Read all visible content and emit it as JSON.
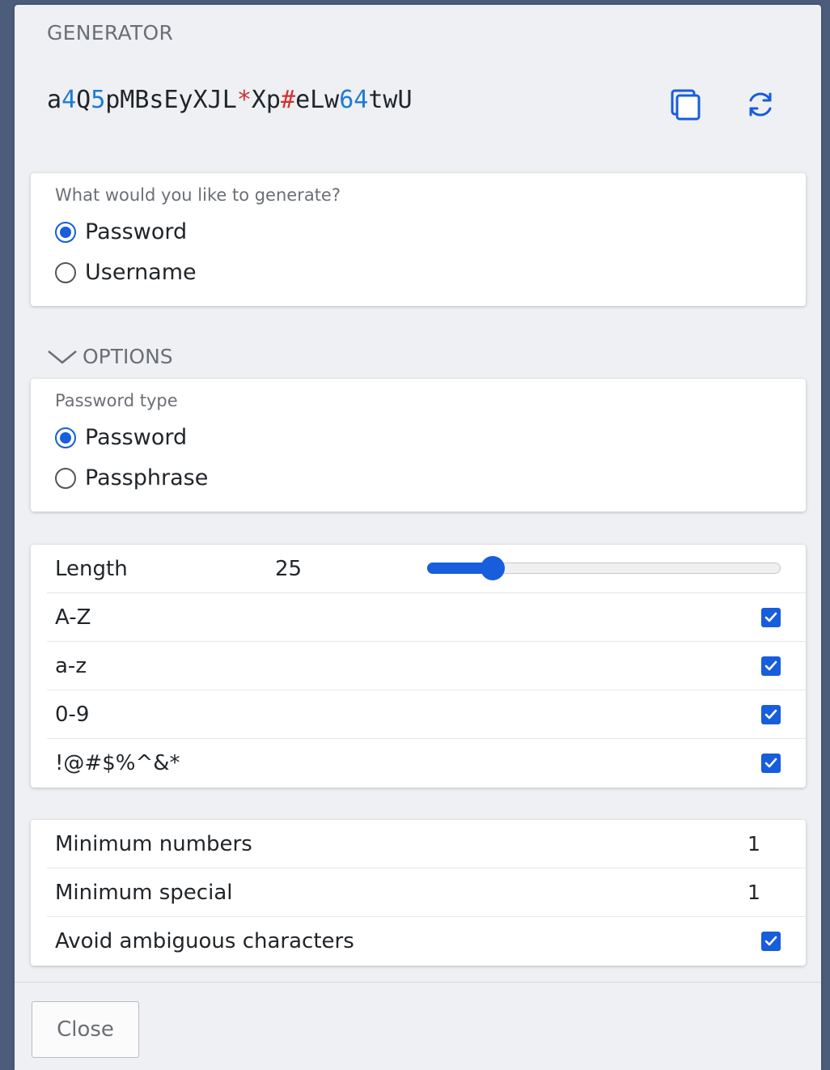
{
  "generator": {
    "title": "GENERATOR",
    "password_segments": [
      {
        "text": "a",
        "kind": "letter"
      },
      {
        "text": "4",
        "kind": "number"
      },
      {
        "text": "Q",
        "kind": "letter"
      },
      {
        "text": "5",
        "kind": "number"
      },
      {
        "text": "pMBsEyXJL",
        "kind": "letter"
      },
      {
        "text": "*",
        "kind": "special"
      },
      {
        "text": "Xp",
        "kind": "letter"
      },
      {
        "text": "#",
        "kind": "special"
      },
      {
        "text": "eLw",
        "kind": "letter"
      },
      {
        "text": "64",
        "kind": "number"
      },
      {
        "text": "twU",
        "kind": "letter"
      }
    ],
    "copy_icon": "copy-icon",
    "regenerate_icon": "refresh-icon"
  },
  "type_card": {
    "label": "What would you like to generate?",
    "options": [
      {
        "label": "Password",
        "checked": true
      },
      {
        "label": "Username",
        "checked": false
      }
    ]
  },
  "options_toggle": {
    "label": "OPTIONS",
    "icon": "chevron-down-icon"
  },
  "password_type_card": {
    "label": "Password type",
    "options": [
      {
        "label": "Password",
        "checked": true
      },
      {
        "label": "Passphrase",
        "checked": false
      }
    ]
  },
  "options_card": {
    "length_label": "Length",
    "length_value": "25",
    "length_slider_fraction": 0.185,
    "charsets": [
      {
        "label": "A-Z",
        "checked": true
      },
      {
        "label": "a-z",
        "checked": true
      },
      {
        "label": "0-9",
        "checked": true
      },
      {
        "label": "!@#$%^&*",
        "checked": true
      }
    ]
  },
  "extra_card": {
    "min_numbers_label": "Minimum numbers",
    "min_numbers_value": "1",
    "min_special_label": "Minimum special",
    "min_special_value": "1",
    "avoid_ambiguous_label": "Avoid ambiguous characters",
    "avoid_ambiguous_checked": true
  },
  "footer": {
    "close_label": "Close"
  },
  "colors": {
    "accent": "#175ddc",
    "number": "#1e7bd4",
    "special": "#d32f2f",
    "overlay": "#4b5d7a"
  }
}
